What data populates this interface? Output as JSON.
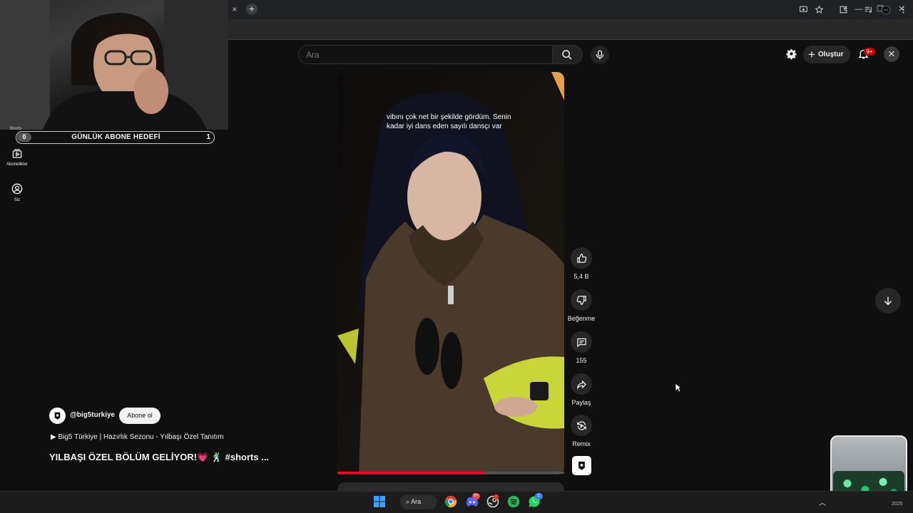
{
  "browser": {
    "tab_close_glyph": "×",
    "new_tab_glyph": "+",
    "window_controls": [
      "—",
      "❐",
      "✕"
    ]
  },
  "header": {
    "search_placeholder": "Ara",
    "create_label": "Oluştur",
    "notifications_badge": "9+"
  },
  "webcam": {
    "goal_label": "GÜNLÜK ABONE HEDEFİ",
    "goal_current": "0",
    "goal_target": "1"
  },
  "sidebar": {
    "items": [
      {
        "label": "Shorts",
        "icon": "shorts-icon"
      },
      {
        "label": "Abonelikler",
        "icon": "subscriptions-icon"
      },
      {
        "label": "Siz",
        "icon": "you-icon"
      }
    ]
  },
  "video": {
    "caption": "vibını çok net bir şekilde gördüm. Senin kadar iyi dans eden sayılı dansçı var",
    "progress": 0.65
  },
  "actions": {
    "like_count": "5,4 B",
    "dislike_label": "Beğenme",
    "comment_count": "155",
    "share_label": "Paylaş",
    "remix_label": "Remix"
  },
  "info": {
    "channel_name": "@big5turkiye",
    "subscribe_label": "Abone ol",
    "playlist": "▶ Big5 Türkiye | Hazırlık Sezonu - Yılbaşı Özel Tanıtım",
    "title": "YILBAŞI ÖZEL BÖLÜM GELİYOR!💗 🕺 #shorts ..."
  },
  "taskbar": {
    "search_label": "Ara",
    "discord_badge": "9+",
    "whatsapp_badge": "1",
    "year": "2025"
  },
  "colors": {
    "accent_red": "#ff0033",
    "background": "#0f0f0f"
  }
}
